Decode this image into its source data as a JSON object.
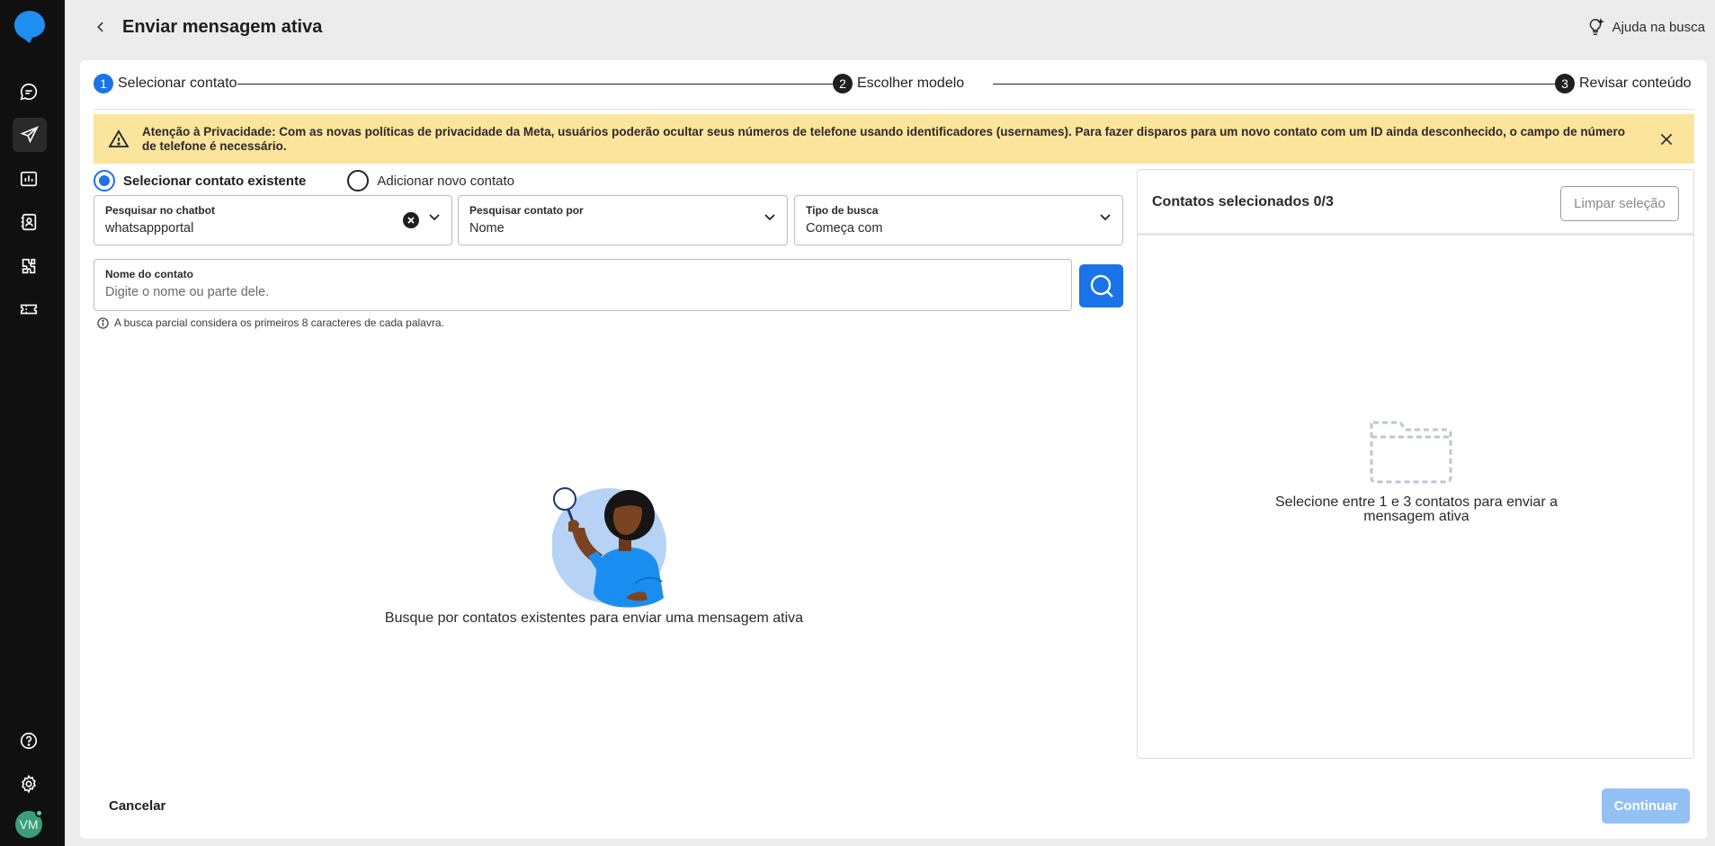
{
  "header": {
    "title": "Enviar mensagem ativa",
    "help_label": "Ajuda na busca"
  },
  "stepper": {
    "steps": [
      {
        "number": "1",
        "label": "Selecionar contato"
      },
      {
        "number": "2",
        "label": "Escolher modelo"
      },
      {
        "number": "3",
        "label": "Revisar conteúdo"
      }
    ]
  },
  "alert": {
    "text": "Atenção à Privacidade: Com as novas políticas de privacidade da Meta, usuários poderão ocultar seus números de telefone usando identificadores (usernames). Para fazer disparos para um novo contato com um ID ainda desconhecido, o campo de número de telefone é necessário."
  },
  "radios": {
    "existing": "Selecionar contato existente",
    "new": "Adicionar novo contato"
  },
  "fields": {
    "chatbot": {
      "label": "Pesquisar no chatbot",
      "value": "whatsappportal"
    },
    "search_by": {
      "label": "Pesquisar contato por",
      "value": "Nome"
    },
    "search_type": {
      "label": "Tipo de busca",
      "value": "Começa com"
    },
    "contact_name": {
      "label": "Nome do contato",
      "placeholder": "Digite o nome ou parte dele."
    }
  },
  "hint": "A busca parcial considera os primeiros 8 caracteres de cada palavra.",
  "empty_left": "Busque por contatos existentes para enviar uma mensagem ativa",
  "panel": {
    "title": "Contatos selecionados 0/3",
    "clear_label": "Limpar seleção",
    "empty_text": "Selecione entre 1 e 3 contatos para enviar a mensagem ativa"
  },
  "footer": {
    "cancel_label": "Cancelar",
    "continue_label": "Continuar"
  },
  "user": {
    "initials": "VM"
  },
  "colors": {
    "primary": "#1a73e8",
    "alert_bg": "#fbe49c",
    "sidebar_bg": "#101010",
    "continue_disabled": "#93c0f5"
  }
}
